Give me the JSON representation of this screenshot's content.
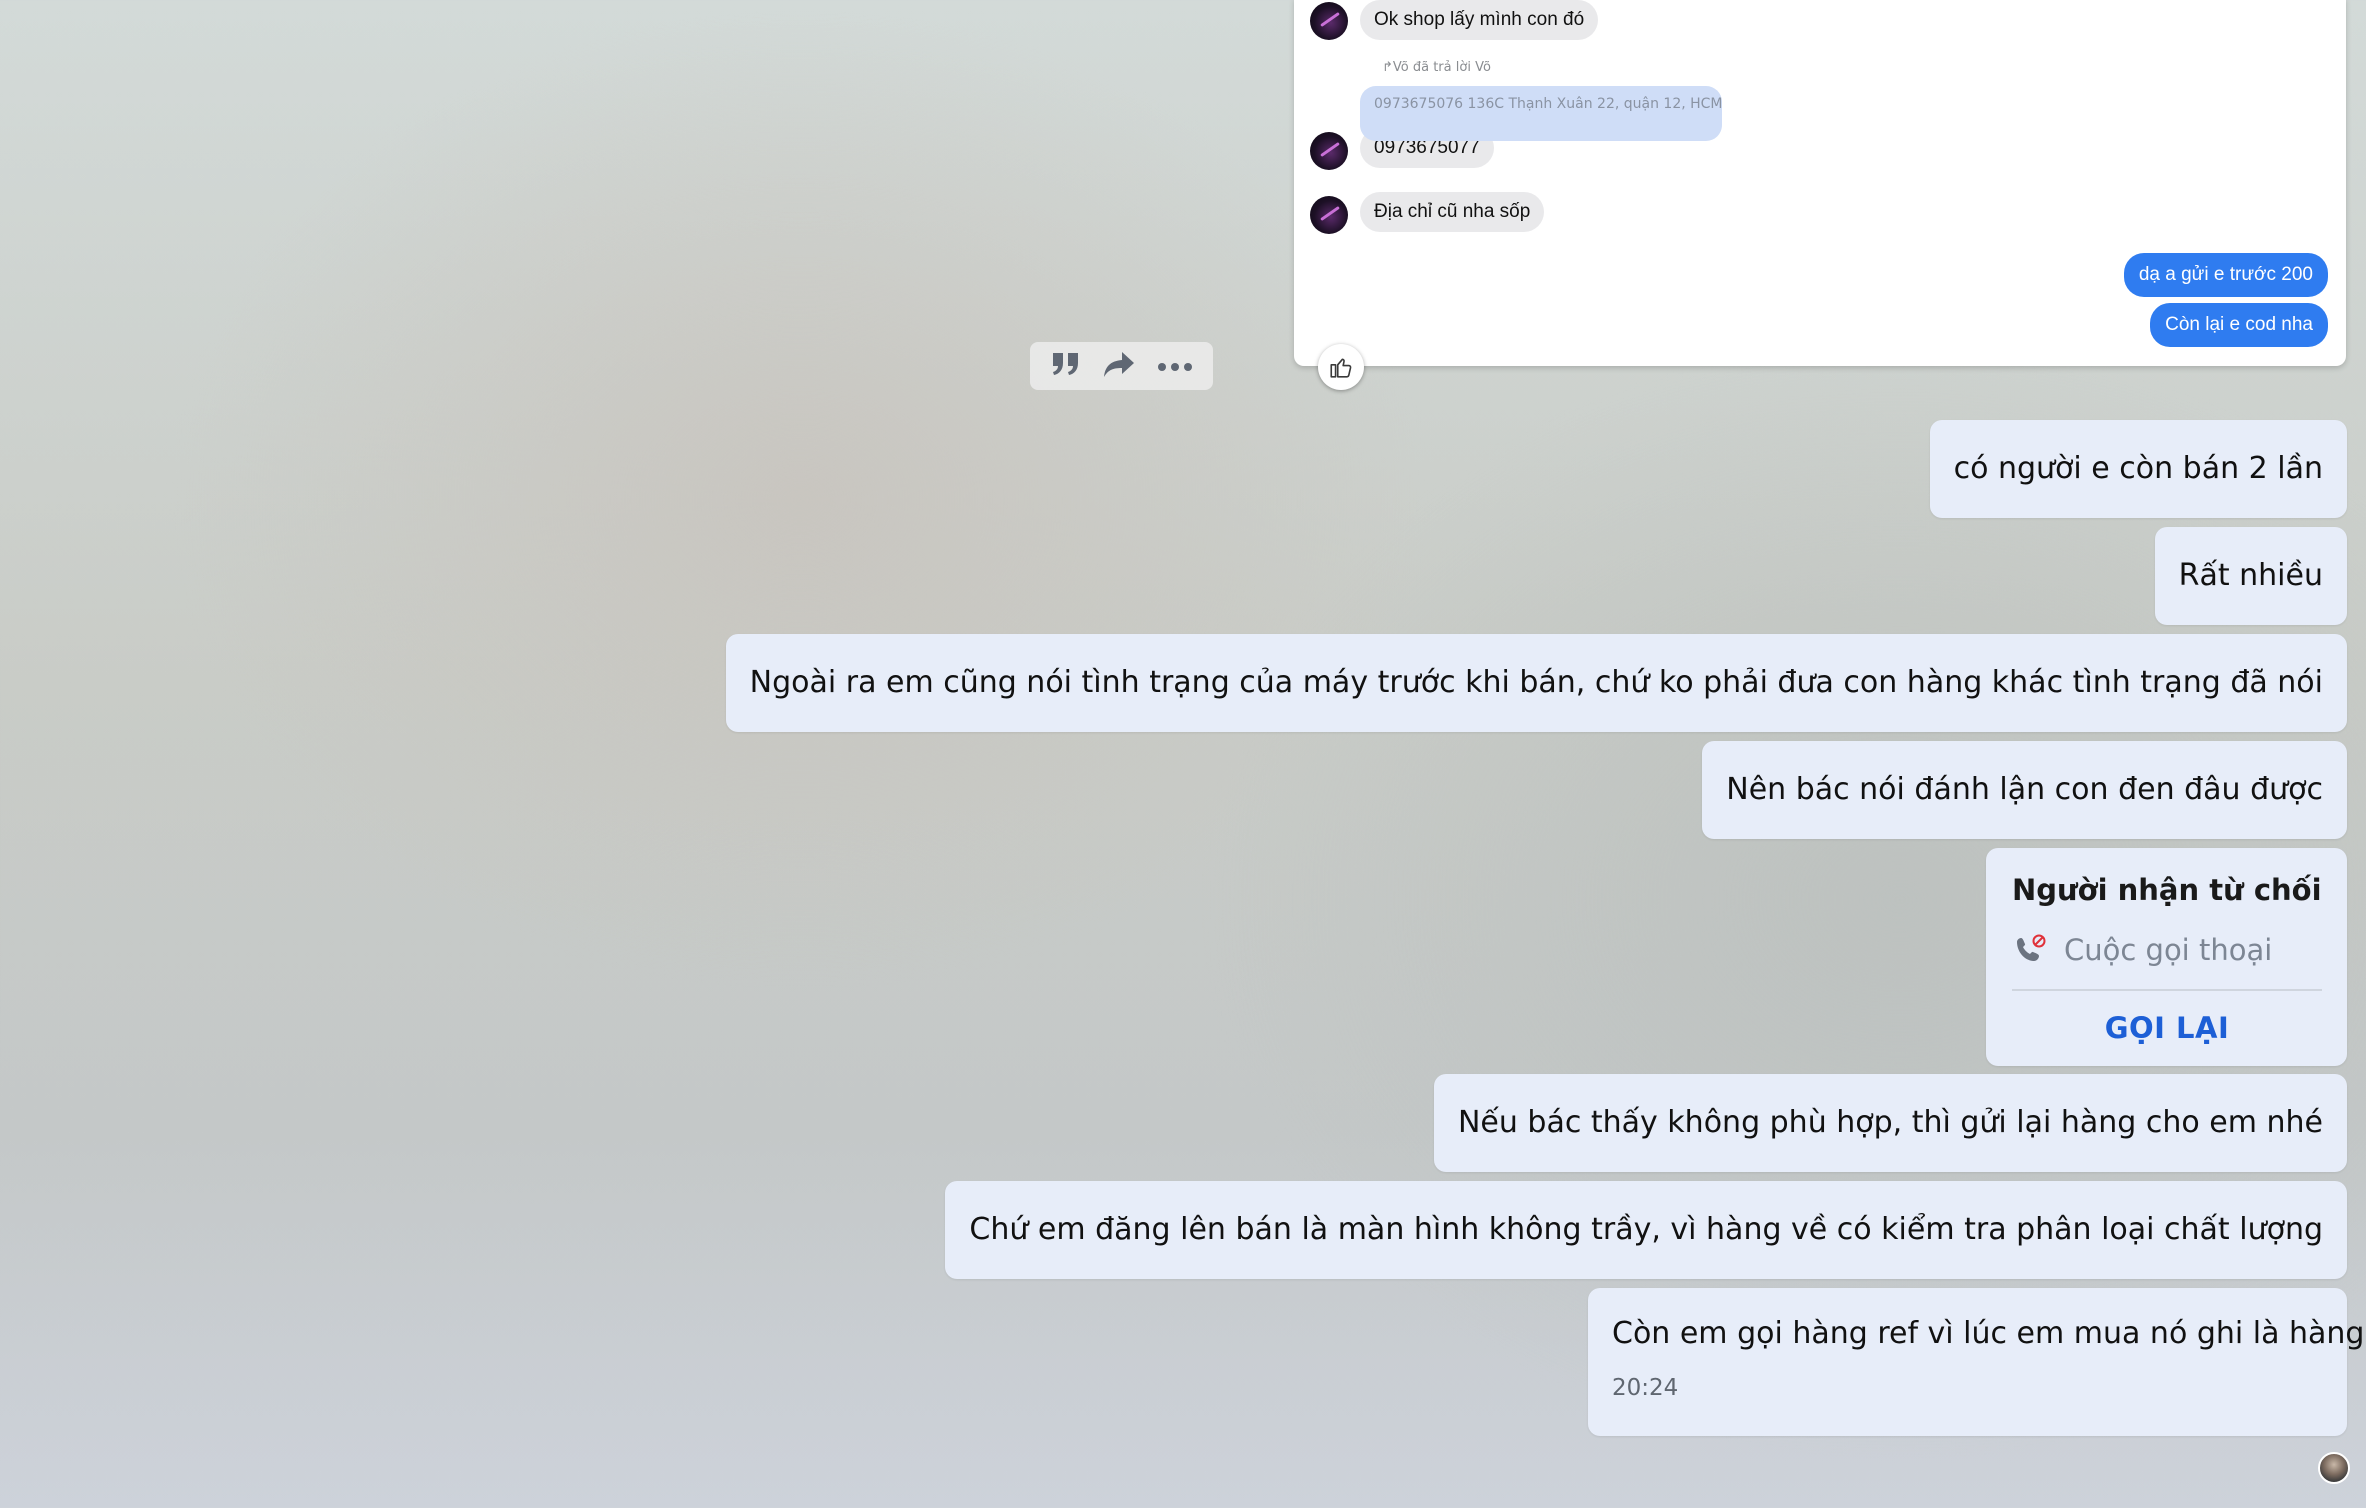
{
  "screenshot": {
    "messages": [
      {
        "text": "Ok shop lấy mình con đó"
      },
      {
        "text": "0973675077"
      },
      {
        "text": "Địa chỉ cũ nha sốp"
      }
    ],
    "reply_label": "↱Võ đã trả lời Võ",
    "quoted_text": "0973675076 136C Thạnh Xuân 22, quận 12, HCM",
    "sent": [
      {
        "text": "dạ a gửi e trước 200"
      },
      {
        "text": "Còn lại e cod nha"
      }
    ]
  },
  "toolbar": {
    "icons": [
      "quote-icon",
      "forward-icon",
      "more-icon"
    ]
  },
  "chat": {
    "messages": [
      {
        "text": "có người e còn bán 2 lần"
      },
      {
        "text": "Rất nhiều"
      },
      {
        "text": "Ngoài ra em cũng nói tình trạng của máy trước khi bán, chứ ko phải đưa con hàng khác tình trạng đã nói"
      },
      {
        "text": "Nên bác nói đánh lận con đen đâu được"
      },
      {
        "text": "Nếu bác thấy không phù hợp, thì gửi lại hàng cho em nhé"
      },
      {
        "text": "Chứ em đăng lên bán là màn hình không trầy, vì hàng về có kiểm tra phân loại chất lượng"
      }
    ],
    "call": {
      "title": "Người nhận từ chối",
      "type": "Cuộc gọi thoại",
      "action": "GỌI LẠI"
    },
    "last_message": {
      "text": "Còn em gọi hàng ref vì lúc em mua nó ghi là hàng ref",
      "time": "20:24"
    }
  },
  "colors": {
    "bubble_bg": "#e7edf9",
    "sent_blue": "#2f7cf0",
    "call_action": "#1d5fd6",
    "missed_red": "#e0313a"
  }
}
